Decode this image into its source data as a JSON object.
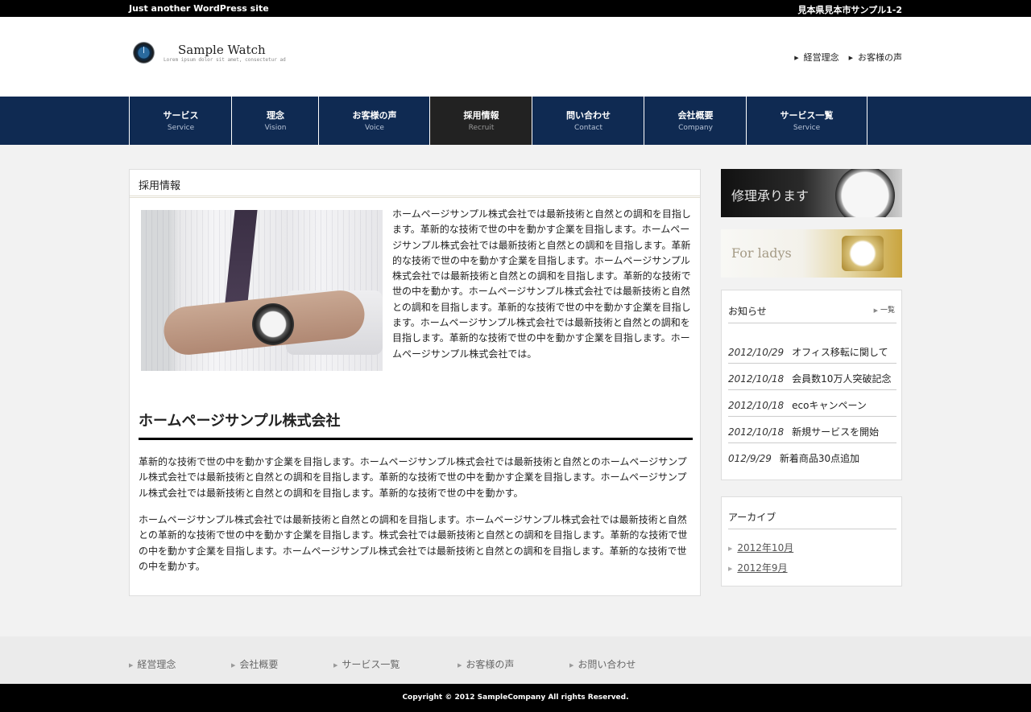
{
  "topbar": {
    "tagline": "Just another WordPress site",
    "address": "見本県見本市サンプル1-2"
  },
  "header": {
    "site_title": "Sample Watch",
    "site_description": "Lorem ipsum dolor sit amet, consectetur ad",
    "links": [
      "経営理念",
      "お客様の声"
    ]
  },
  "nav": {
    "items": [
      {
        "jp": "サービス",
        "en": "Service"
      },
      {
        "jp": "理念",
        "en": "Vision"
      },
      {
        "jp": "お客様の声",
        "en": "Voice"
      },
      {
        "jp": "採用情報",
        "en": "Recruit"
      },
      {
        "jp": "問い合わせ",
        "en": "Contact"
      },
      {
        "jp": "会社概要",
        "en": "Company"
      },
      {
        "jp": "サービス一覧",
        "en": "Service"
      }
    ]
  },
  "main": {
    "page_title": "採用情報",
    "intro": "ホームページサンプル株式会社では最新技術と自然との調和を目指します。革新的な技術で世の中を動かす企業を目指します。ホームページサンプル株式会社では最新技術と自然との調和を目指します。革新的な技術で世の中を動かす企業を目指します。ホームページサンプル株式会社では最新技術と自然との調和を目指します。革新的な技術で世の中を動かす。ホームページサンプル株式会社では最新技術と自然との調和を目指します。革新的な技術で世の中を動かす企業を目指します。ホームページサンプル株式会社では最新技術と自然との調和を目指します。革新的な技術で世の中を動かす企業を目指します。ホームページサンプル株式会社では。",
    "section_title": "ホームページサンプル株式会社",
    "paragraph1": "革新的な技術で世の中を動かす企業を目指します。ホームページサンプル株式会社では最新技術と自然とのホームページサンプル株式会社では最新技術と自然との調和を目指します。革新的な技術で世の中を動かす企業を目指します。ホームページサンプル株式会社では最新技術と自然との調和を目指します。革新的な技術で世の中を動かす。",
    "paragraph2": "ホームページサンプル株式会社では最新技術と自然との調和を目指します。ホームページサンプル株式会社では最新技術と自然との革新的な技術で世の中を動かす企業を目指します。株式会社では最新技術と自然との調和を目指します。革新的な技術で世の中を動かす企業を目指します。ホームページサンプル株式会社では最新技術と自然との調和を目指します。革新的な技術で世の中を動かす。"
  },
  "sidebar": {
    "banner1": "修理承ります",
    "banner2": "For ladys",
    "news": {
      "title": "お知らせ",
      "more": "一覧",
      "items": [
        {
          "date": "2012/10/29",
          "text": "オフィス移転に関して"
        },
        {
          "date": "2012/10/18",
          "text": "会員数10万人突破記念"
        },
        {
          "date": "2012/10/18",
          "text": "ecoキャンペーン"
        },
        {
          "date": "2012/10/18",
          "text": "新規サービスを開始"
        },
        {
          "date": "012/9/29",
          "text": "新着商品30点追加"
        }
      ]
    },
    "archive": {
      "title": "アーカイブ",
      "items": [
        "2012年10月",
        "2012年9月"
      ]
    }
  },
  "footer": {
    "links": [
      "経営理念",
      "会社概要",
      "サービス一覧",
      "お客様の声",
      "お問い合わせ"
    ],
    "copyright": "Copyright © 2012 SampleCompany All rights Reserved."
  },
  "colors": {
    "nav_background": "#0f2a52",
    "nav_active": "#222222",
    "topbar": "#000000"
  }
}
